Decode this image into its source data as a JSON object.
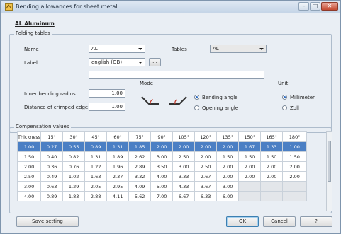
{
  "window": {
    "title": "Bending allowances for sheet metal",
    "minimize": "–",
    "maximize": "□",
    "close": "✕"
  },
  "material_heading": "AL Aluminum",
  "folding": {
    "group_label": "Folding tables",
    "name_label": "Name",
    "name_value": "AL",
    "tables_label": "Tables",
    "tables_value": "AL",
    "label_label": "Label",
    "label_value": "english (GB)",
    "ellipsis": "...",
    "description_value": "",
    "inner_radius_label": "Inner bending radius",
    "inner_radius_value": "1.00",
    "crimped_label": "Distance of crimped edge",
    "crimped_value": "1.00",
    "mode_label": "Mode",
    "mode_bending": "Bending angle",
    "mode_opening": "Opening angle",
    "unit_label": "Unit",
    "unit_mm": "Millimeter",
    "unit_zoll": "Zoll"
  },
  "compensation": {
    "group_label": "Compensation values",
    "headers": [
      "Thickness",
      "15°",
      "30°",
      "45°",
      "60°",
      "75°",
      "90°",
      "105°",
      "120°",
      "135°",
      "150°",
      "165°",
      "180°"
    ],
    "rows": [
      [
        "1.00",
        "0.27",
        "0.55",
        "0.89",
        "1.31",
        "1.85",
        "2.00",
        "2.00",
        "2.00",
        "2.00",
        "1.67",
        "1.33",
        "1.00"
      ],
      [
        "1.50",
        "0.40",
        "0.82",
        "1.31",
        "1.89",
        "2.62",
        "3.00",
        "2.50",
        "2.00",
        "1.50",
        "1.50",
        "1.50",
        "1.50"
      ],
      [
        "2.00",
        "0.36",
        "0.76",
        "1.22",
        "1.96",
        "2.89",
        "3.50",
        "3.00",
        "2.50",
        "2.00",
        "2.00",
        "2.00",
        "2.00"
      ],
      [
        "2.50",
        "0.49",
        "1.02",
        "1.63",
        "2.37",
        "3.32",
        "4.00",
        "3.33",
        "2.67",
        "2.00",
        "2.00",
        "2.00",
        "2.00"
      ],
      [
        "3.00",
        "0.63",
        "1.29",
        "2.05",
        "2.95",
        "4.09",
        "5.00",
        "4.33",
        "3.67",
        "3.00",
        "",
        "",
        ""
      ],
      [
        "4.00",
        "0.89",
        "1.83",
        "2.88",
        "4.11",
        "5.62",
        "7.00",
        "6.67",
        "6.33",
        "6.00",
        "",
        "",
        ""
      ]
    ],
    "selected_row": 0
  },
  "buttons": {
    "save": "Save setting",
    "ok": "OK",
    "cancel": "Cancel",
    "help": "?"
  }
}
